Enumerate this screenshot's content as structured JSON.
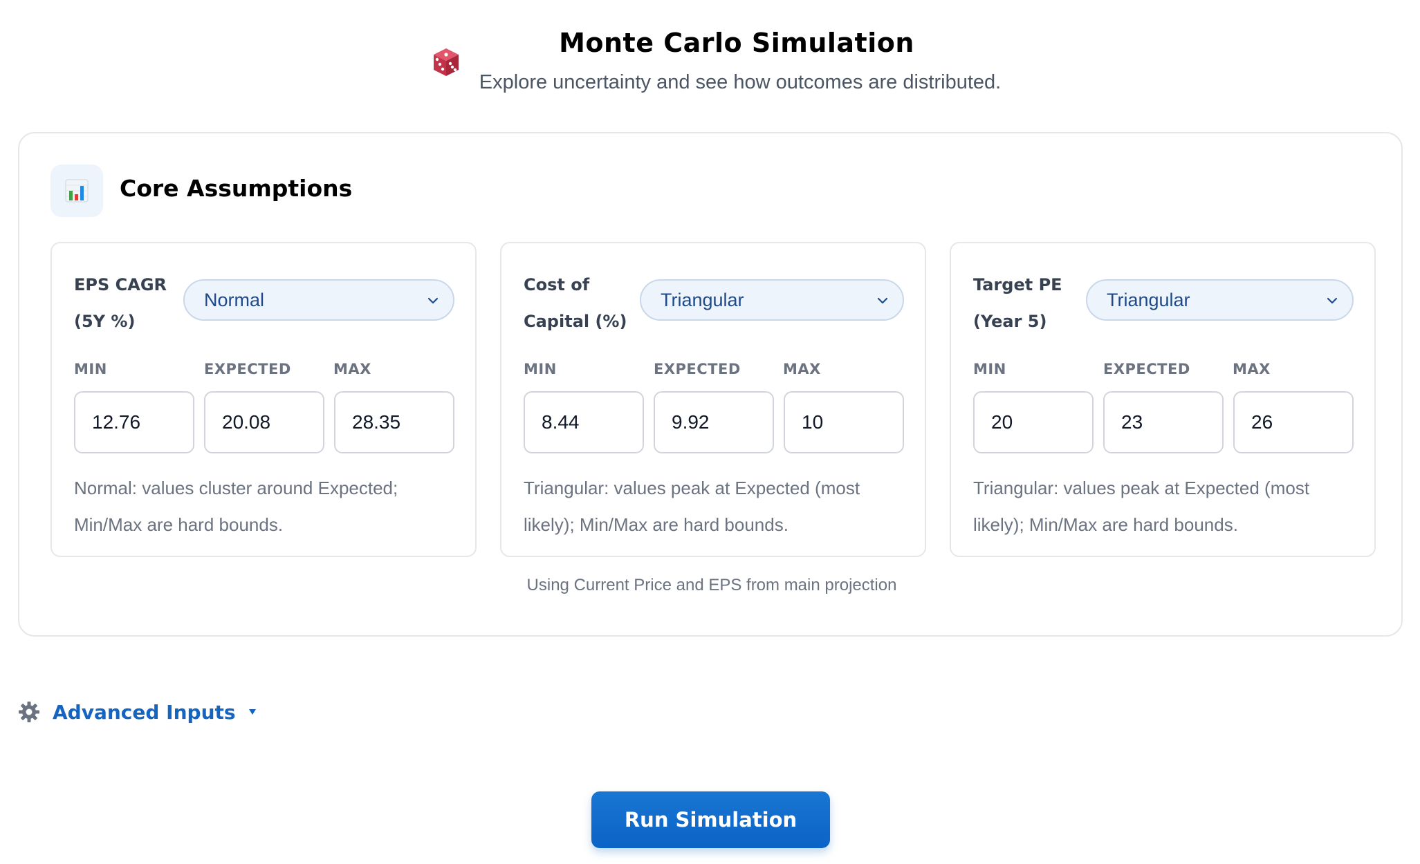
{
  "header": {
    "icon": "dice-icon",
    "title": "Monte Carlo Simulation",
    "subtitle": "Explore uncertainty and see how outcomes are distributed."
  },
  "core": {
    "icon": "bar-chart-icon",
    "title": "Core Assumptions",
    "panels": [
      {
        "label": "EPS CAGR (5Y %)",
        "distribution": "Normal",
        "min_label": "MIN",
        "expected_label": "EXPECTED",
        "max_label": "MAX",
        "min": "12.76",
        "expected": "20.08",
        "max": "28.35",
        "note": "Normal: values cluster around Expected; Min/Max are hard bounds."
      },
      {
        "label": "Cost of Capital (%)",
        "distribution": "Triangular",
        "min_label": "MIN",
        "expected_label": "EXPECTED",
        "max_label": "MAX",
        "min": "8.44",
        "expected": "9.92",
        "max": "10",
        "note": "Triangular: values peak at Expected (most likely); Min/Max are hard bounds."
      },
      {
        "label": "Target PE (Year 5)",
        "distribution": "Triangular",
        "min_label": "MIN",
        "expected_label": "EXPECTED",
        "max_label": "MAX",
        "min": "20",
        "expected": "23",
        "max": "26",
        "note": "Triangular: values peak at Expected (most likely); Min/Max are hard bounds."
      }
    ],
    "footnote": "Using Current Price and EPS from main projection"
  },
  "advanced": {
    "icon": "gear-icon",
    "label": "Advanced Inputs",
    "caret_icon": "caret-down-icon"
  },
  "run_button_label": "Run Simulation",
  "colors": {
    "accent": "#1565c0",
    "button": "#1976d2",
    "select_bg": "#eef4fb",
    "border": "#e5e7eb"
  }
}
